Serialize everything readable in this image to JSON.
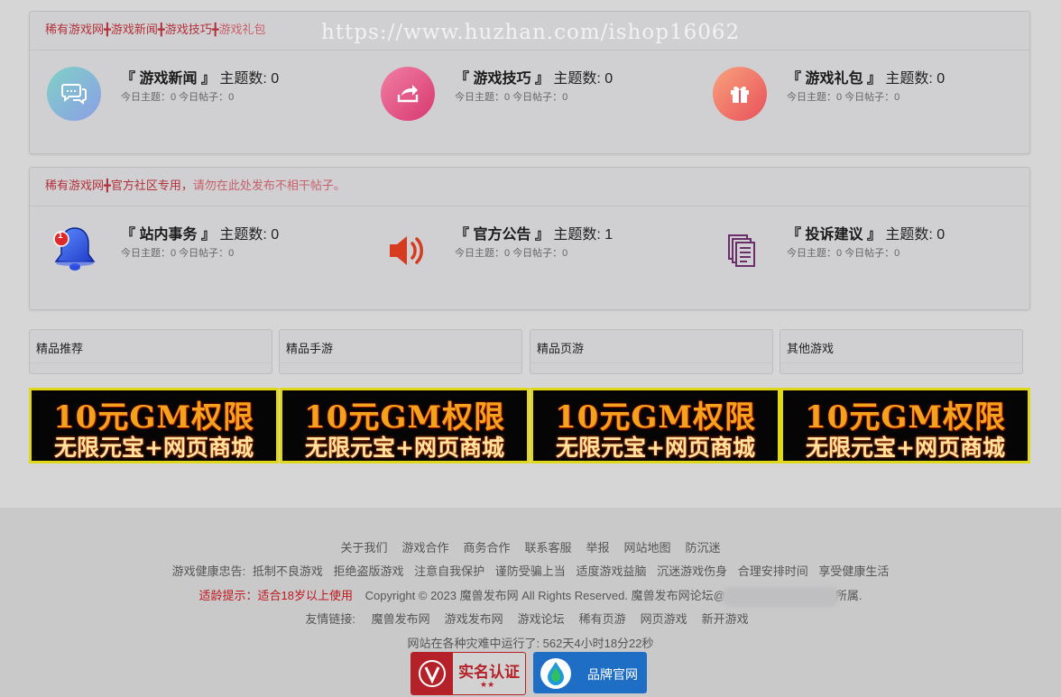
{
  "watermark": "https://www.huzhan.com/ishop16062",
  "section1": {
    "crumbs": [
      "稀有游戏网",
      "游戏新闻",
      "游戏技巧",
      "游戏礼包"
    ],
    "forums": [
      {
        "name": "『 游戏新闻 』",
        "count_label": "主题数:",
        "count": "0",
        "stats": "今日主题：0 今日帖子：0",
        "icon": "chat-bubble-icon"
      },
      {
        "name": "『 游戏技巧 』",
        "count_label": "主题数:",
        "count": "0",
        "stats": "今日主题：0 今日帖子：0",
        "icon": "share-arrow-icon"
      },
      {
        "name": "『 游戏礼包 』",
        "count_label": "主题数:",
        "count": "0",
        "stats": "今日主题：0 今日帖子：0",
        "icon": "gift-icon"
      }
    ]
  },
  "section2": {
    "crumb_site": "稀有游戏网",
    "crumb_text": "官方社区专用，",
    "crumb_note": "请勿在此处发布不相干帖子。",
    "forums": [
      {
        "name": "『 站内事务 』",
        "count_label": "主题数:",
        "count": "0",
        "stats": "今日主题：0 今日帖子：0",
        "icon": "bell-icon",
        "badge": "1"
      },
      {
        "name": "『 官方公告 』",
        "count_label": "主题数:",
        "count": "1",
        "stats": "今日主题：0 今日帖子：0",
        "icon": "speaker-icon"
      },
      {
        "name": "『 投诉建议 』",
        "count_label": "主题数:",
        "count": "0",
        "stats": "今日主题：0 今日帖子：0",
        "icon": "documents-icon"
      }
    ]
  },
  "tabs": [
    "精品推荐",
    "精品手游",
    "精品页游",
    "其他游戏"
  ],
  "banner": {
    "line1": "10元GM权限",
    "line2": "无限元宝+网页商城"
  },
  "footer": {
    "nav": [
      "关于我们",
      "游戏合作",
      "商务合作",
      "联系客服",
      "举报",
      "网站地图",
      "防沉迷"
    ],
    "health_label": "游戏健康忠告:",
    "health": [
      "抵制不良游戏",
      "拒绝盗版游戏",
      "注意自我保护",
      "谨防受骗上当",
      "适度游戏益脑",
      "沉迷游戏伤身",
      "合理安排时间",
      "享受健康生活"
    ],
    "age_warning": "适龄提示：适合18岁以上使用",
    "copyright": "Copyright © 2023 魔兽发布网 All Rights Reserved. 魔兽发布网论坛@",
    "copyright_tail": "所属.",
    "links_label": "友情链接:",
    "links": [
      "魔兽发布网",
      "游戏发布网",
      "游戏论坛",
      "稀有页游",
      "网页游戏",
      "新开游戏"
    ],
    "uptime": "网站在各种灾难中运行了: 562天4小时18分22秒",
    "badge_realname": "实名认证",
    "badge_stars": "★★",
    "badge_brand": "品牌官网"
  },
  "colors": {
    "accent_red": "#b3303a",
    "banner_border": "#e2d81a",
    "brand_blue": "#1f6ec6"
  }
}
